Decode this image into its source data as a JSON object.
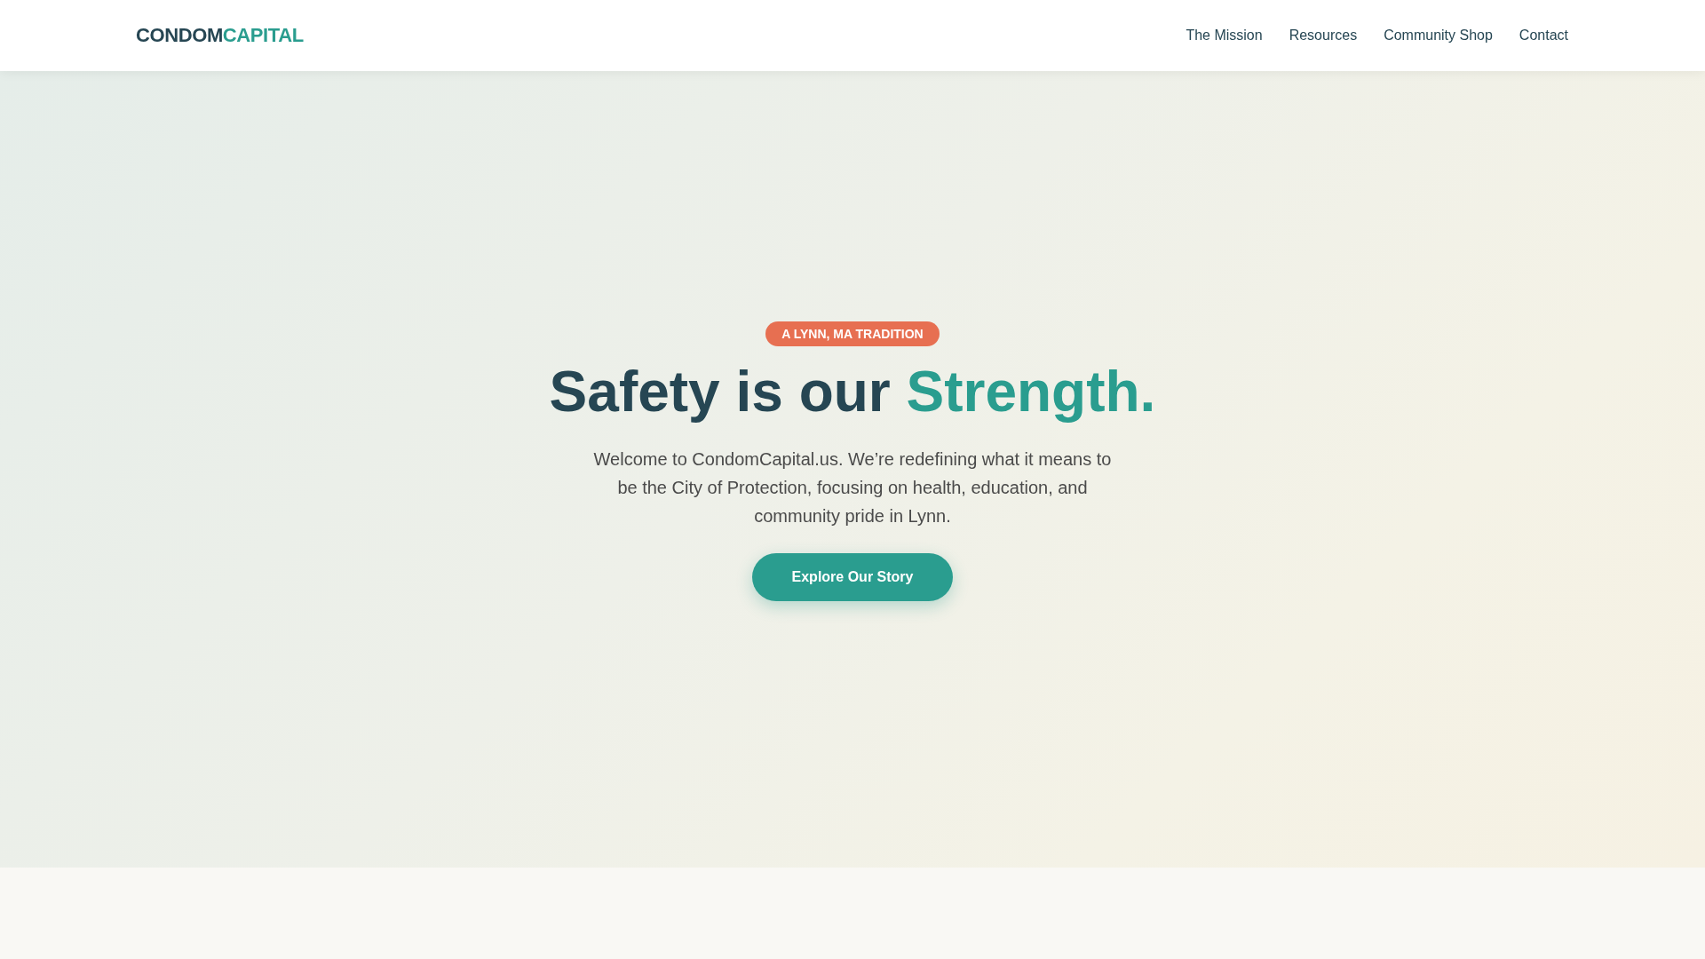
{
  "header": {
    "logo": {
      "first": "CONDOM",
      "second": "CAPITAL"
    },
    "nav": [
      "The Mission",
      "Resources",
      "Community Shop",
      "Contact"
    ]
  },
  "hero": {
    "badge": "A LYNN, MA TRADITION",
    "headline": {
      "text": "Safety is our",
      "highlight": "Strength."
    },
    "intro": "Welcome to CondomCapital.us. We’re redefining what it means to be the City of Protection, focusing on health, education, and community pride in Lynn.",
    "button": "Explore Our Story"
  }
}
